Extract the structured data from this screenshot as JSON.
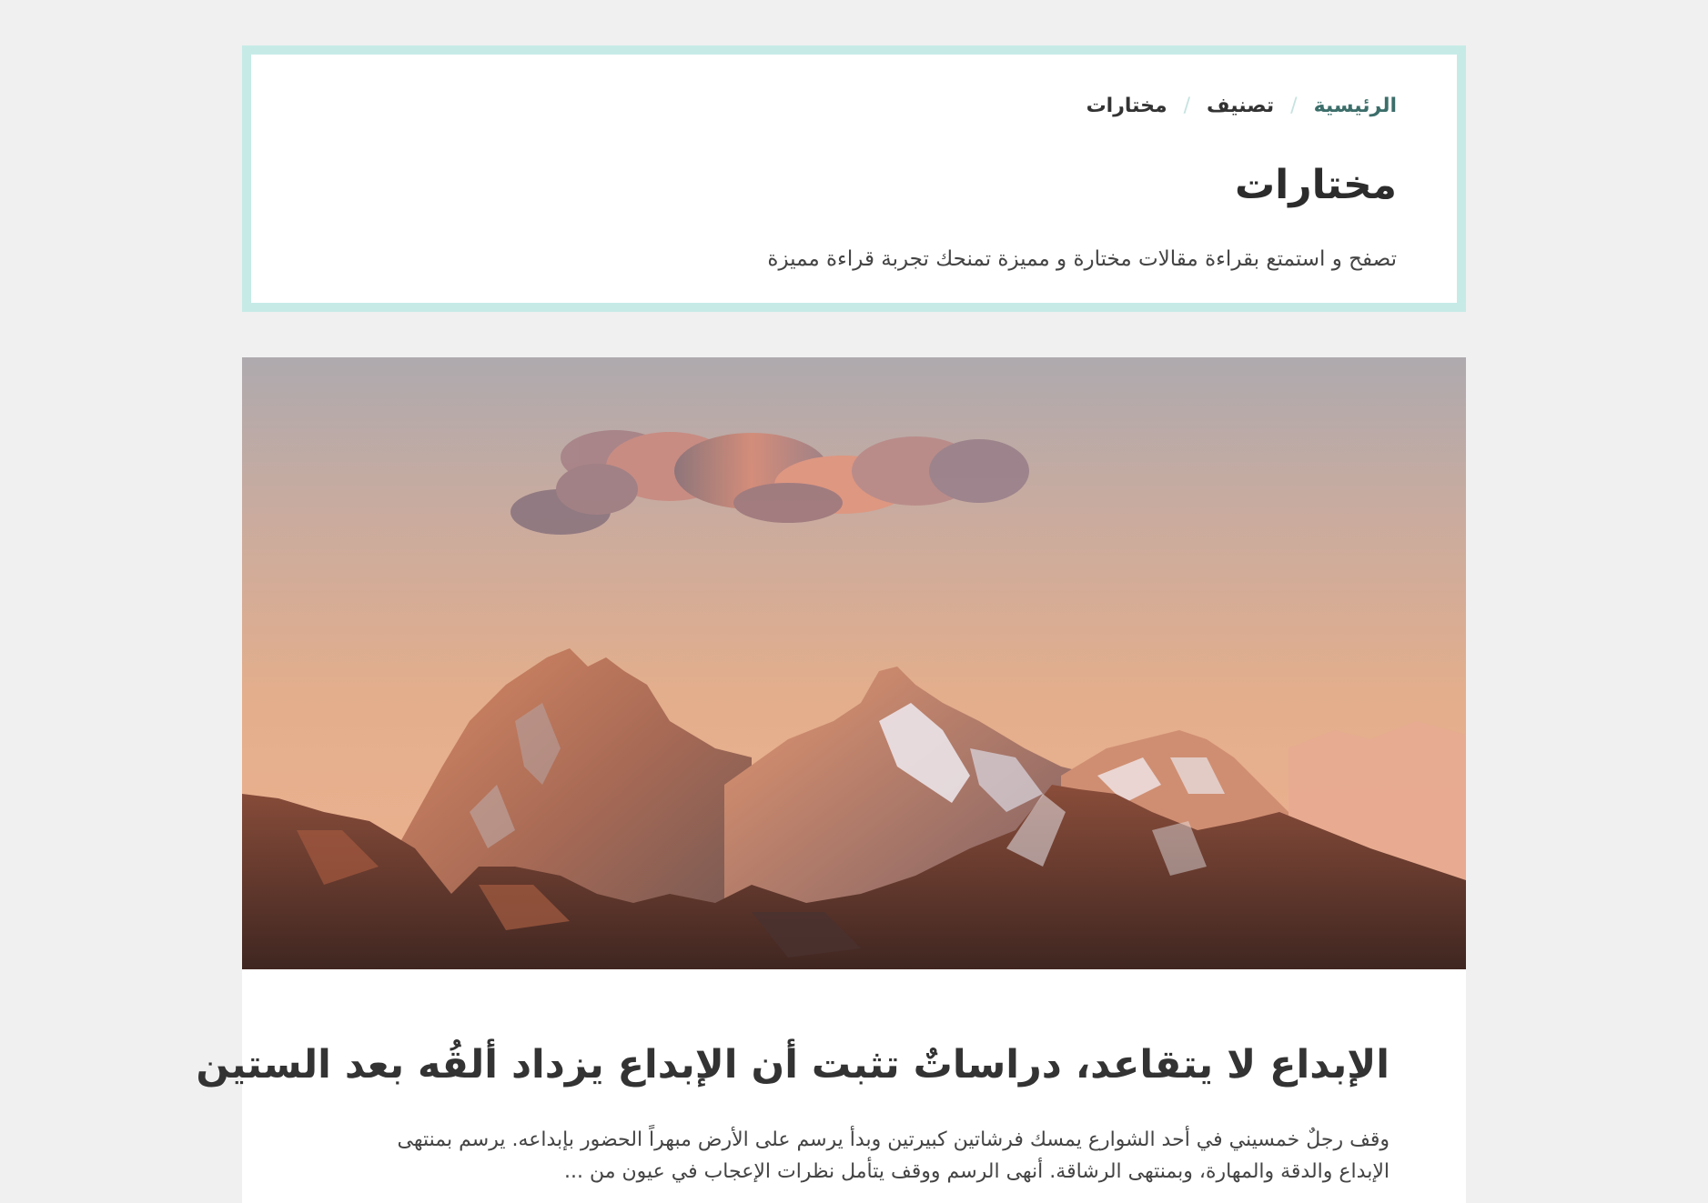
{
  "breadcrumb": {
    "home": "الرئيسية",
    "category": "تصنيف",
    "current": "مختارات",
    "separator": "/"
  },
  "header": {
    "title": "مختارات",
    "subtitle": "تصفح و استمتع بقراءة مقالات مختارة و مميزة تمنحك تجربة قراءة مميزة"
  },
  "article": {
    "image_alt": "mountain-range-at-sunset",
    "title": "الإبداع لا يتقاعد، دراساتٌ تثبت أن الإبداع يزداد ألقُه بعد الستين",
    "excerpt": "وقف رجلٌ خمسيني في أحد الشوارع يمسك فرشاتين كبيرتين وبدأ يرسم على الأرض مبهراً الحضور بإبداعه. يرسم بمنتهى الإبداع والدقة والمهارة، وبمنتهى الرشاقة. أنهى الرسم ووقف يتأمل نظرات الإعجاب في عيون من ..."
  },
  "colors": {
    "background": "#f0f0f0",
    "card_border": "#c6ebe7",
    "breadcrumb_link": "#3c6e6a",
    "text_dark": "#2c2c2c"
  }
}
